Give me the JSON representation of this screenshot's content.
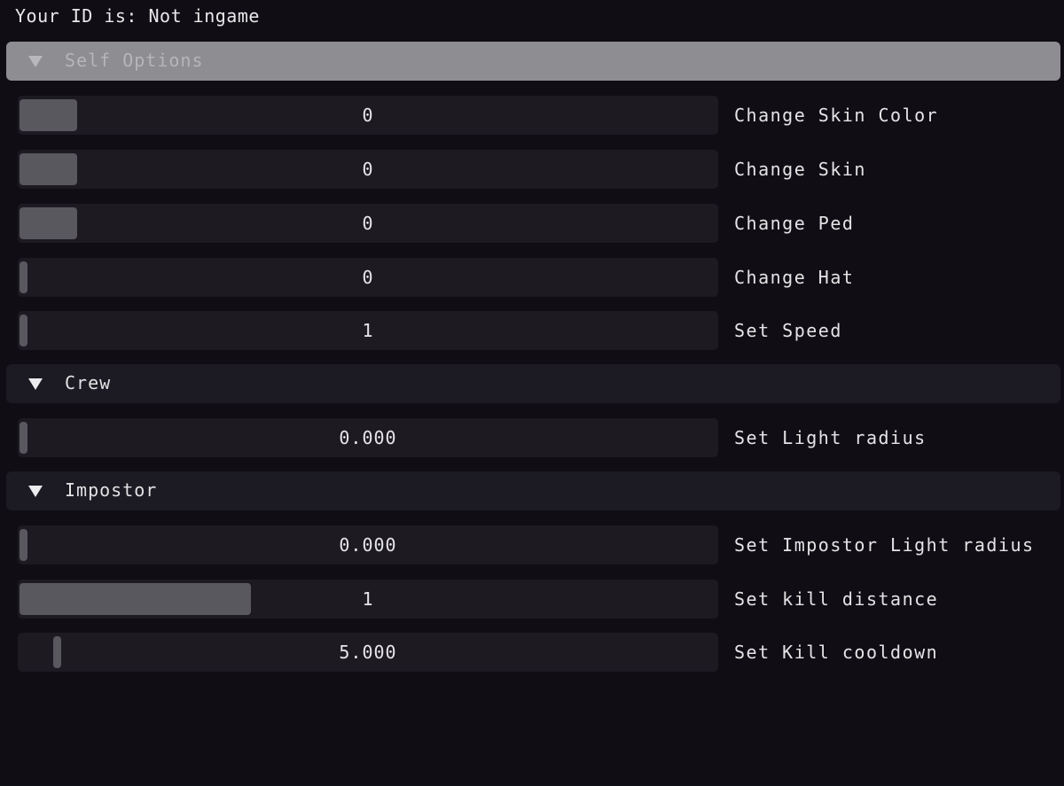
{
  "status": {
    "id_text": "Your ID is: Not ingame"
  },
  "sections": {
    "self": {
      "title": "Self Options",
      "sliders": [
        {
          "value_text": "0",
          "label": "Change Skin Color",
          "level": 0
        },
        {
          "value_text": "0",
          "label": "Change Skin",
          "level": 0
        },
        {
          "value_text": "0",
          "label": "Change Ped",
          "level": 0
        },
        {
          "value_text": "0",
          "label": "Change Hat",
          "level": 0
        },
        {
          "value_text": "1",
          "label": "Set Speed",
          "level": 0
        }
      ]
    },
    "crew": {
      "title": "Crew",
      "sliders": [
        {
          "value_text": "0.000",
          "label": "Set Light radius",
          "level": 0
        }
      ]
    },
    "impostor": {
      "title": "Impostor",
      "sliders": [
        {
          "value_text": "0.000",
          "label": "Set Impostor Light radius",
          "level": 0
        },
        {
          "value_text": "1",
          "label": "Set kill distance",
          "level": 0
        },
        {
          "value_text": "5.000",
          "label": "Set Kill cooldown",
          "level": 0.06
        }
      ]
    }
  },
  "theme": {
    "background": "#110d14",
    "frame_bg": "#1d1a22",
    "slider_grab": "#59585f",
    "header_active": "#8e8d92",
    "text": "#e4e4e6"
  }
}
